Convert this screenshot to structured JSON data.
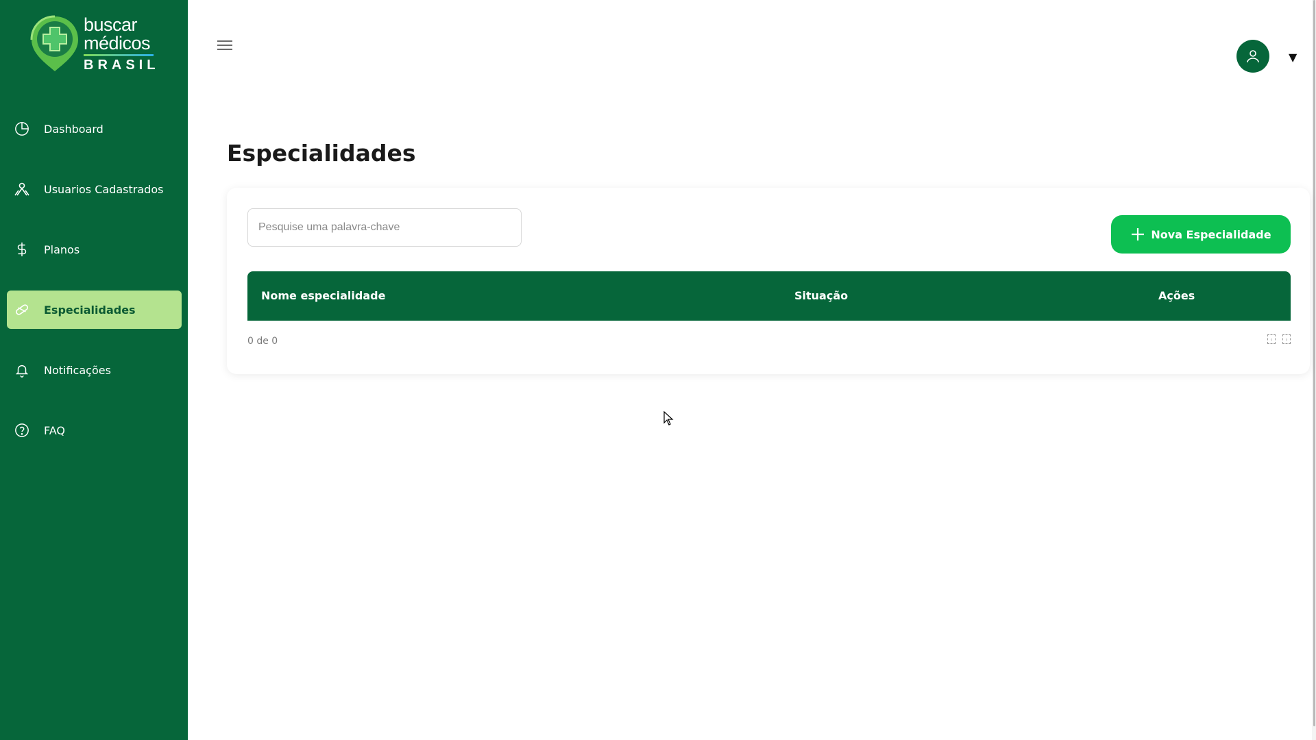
{
  "logo": {
    "line1": "buscar",
    "line2": "médicos",
    "line3": "BRASIL",
    "colors": {
      "background": "#06663a",
      "mark_outer": "#5bbf4a",
      "mark_inner": "#1a7d45"
    }
  },
  "sidebar": {
    "items": [
      {
        "label": "Dashboard",
        "icon": "pie-chart-icon",
        "active": false
      },
      {
        "label": "Usuarios Cadastrados",
        "icon": "users-icon",
        "active": false
      },
      {
        "label": "Planos",
        "icon": "dollar-icon",
        "active": false
      },
      {
        "label": "Especialidades",
        "icon": "pill-icon",
        "active": true
      },
      {
        "label": "Notificações",
        "icon": "bell-icon",
        "active": false
      },
      {
        "label": "FAQ",
        "icon": "help-circle-icon",
        "active": false
      }
    ]
  },
  "header": {
    "menu_icon": "hamburger-icon",
    "avatar_icon": "user-icon",
    "caret": "▼"
  },
  "page": {
    "title": "Especialidades"
  },
  "search": {
    "placeholder": "Pesquise uma palavra-chave",
    "value": ""
  },
  "toolbar": {
    "new_label": "Nova Especialidade"
  },
  "table": {
    "columns": [
      "Nome especialidade",
      "Situação",
      "Ações"
    ],
    "rows": []
  },
  "pagination": {
    "info": "0 de 0"
  },
  "colors": {
    "primary": "#06663a",
    "accent": "#0dbf52",
    "active_nav": "#b4e38f"
  }
}
